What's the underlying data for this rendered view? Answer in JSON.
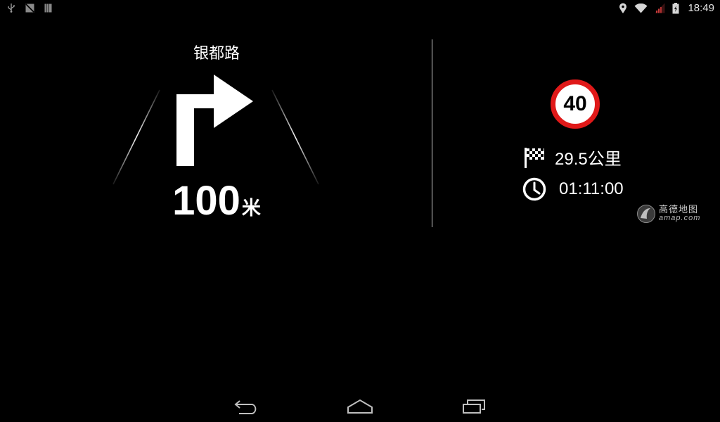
{
  "status_bar": {
    "left_icons": [
      "usb-icon",
      "screenshot-icon",
      "notification-icon"
    ],
    "right_icons": [
      "location-icon",
      "wifi-icon",
      "signal-icon",
      "battery-icon"
    ],
    "time": "18:49"
  },
  "navigation": {
    "road_name": "银都路",
    "maneuver": "turn-right-arrow-icon",
    "distance_value": "100",
    "distance_unit": "米"
  },
  "trip_info": {
    "speed_limit": "40",
    "remaining_distance": "29.5公里",
    "remaining_time": "01:11:00",
    "distance_icon": "checkered-flag-icon",
    "time_icon": "clock-icon"
  },
  "brand": {
    "name": "高德地图",
    "url": "amap.com"
  },
  "nav_bar": {
    "buttons": [
      "back-icon",
      "home-icon",
      "recent-apps-icon"
    ]
  },
  "colors": {
    "background": "#000000",
    "foreground": "#ffffff",
    "speed_sign_border": "#e01919"
  }
}
